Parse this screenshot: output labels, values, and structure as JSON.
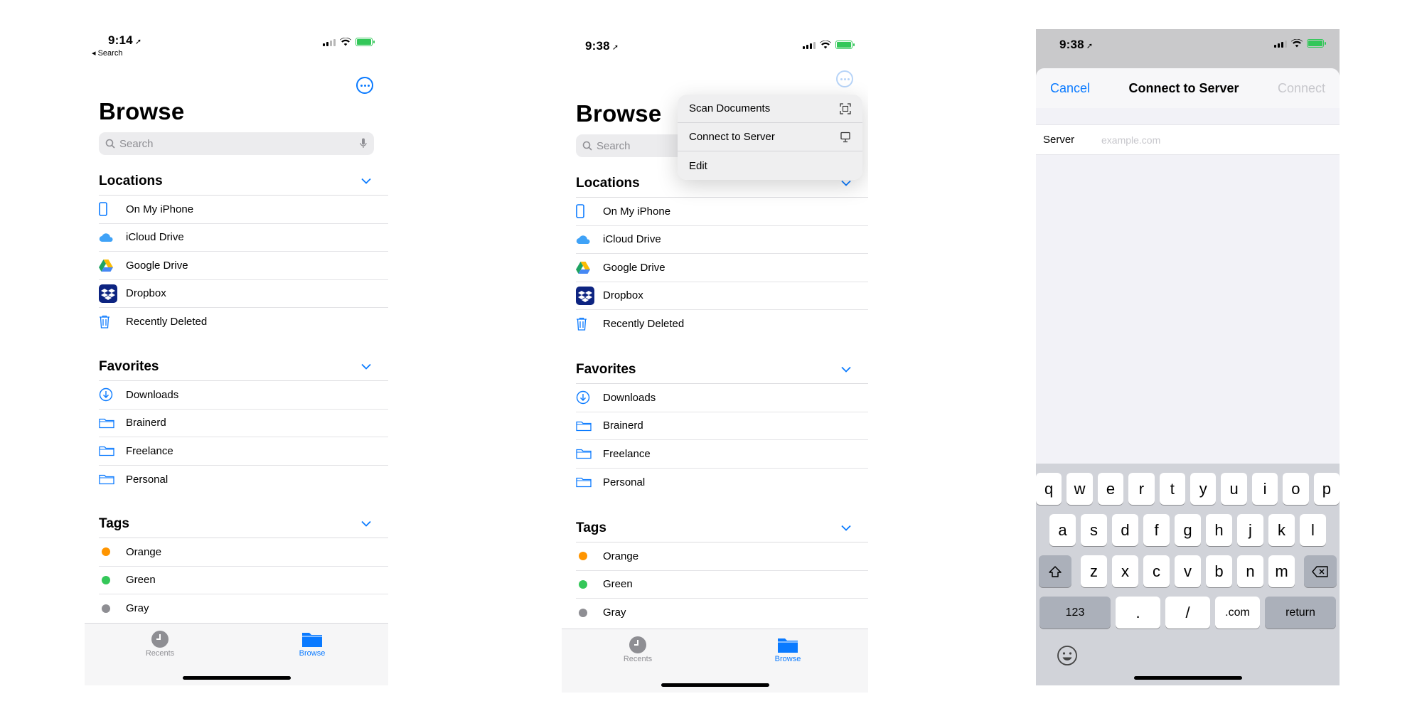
{
  "screen1": {
    "time": "9:14",
    "back_label": "◂ Search",
    "title": "Browse",
    "search_placeholder": "Search",
    "sections": [
      {
        "title": "Locations",
        "items": [
          "On My iPhone",
          "iCloud Drive",
          "Google Drive",
          "Dropbox",
          "Recently Deleted"
        ]
      },
      {
        "title": "Favorites",
        "items": [
          "Downloads",
          "Brainerd",
          "Freelance",
          "Personal"
        ]
      },
      {
        "title": "Tags",
        "items": [
          "Orange",
          "Green",
          "Gray"
        ]
      }
    ],
    "tabs": [
      "Recents",
      "Browse"
    ]
  },
  "screen2": {
    "time": "9:38",
    "title": "Browse",
    "search_placeholder": "Search",
    "menu": [
      "Scan Documents",
      "Connect to Server",
      "Edit"
    ],
    "sections": [
      {
        "title": "Locations",
        "items": [
          "On My iPhone",
          "iCloud Drive",
          "Google Drive",
          "Dropbox",
          "Recently Deleted"
        ]
      },
      {
        "title": "Favorites",
        "items": [
          "Downloads",
          "Brainerd",
          "Freelance",
          "Personal"
        ]
      },
      {
        "title": "Tags",
        "items": [
          "Orange",
          "Green",
          "Gray"
        ]
      }
    ],
    "tabs": [
      "Recents",
      "Browse"
    ]
  },
  "screen3": {
    "time": "9:38",
    "cancel": "Cancel",
    "heading": "Connect to Server",
    "connect": "Connect",
    "server_label": "Server",
    "server_placeholder": "example.com",
    "keys_row1": [
      "q",
      "w",
      "e",
      "r",
      "t",
      "y",
      "u",
      "i",
      "o",
      "p"
    ],
    "keys_row2": [
      "a",
      "s",
      "d",
      "f",
      "g",
      "h",
      "j",
      "k",
      "l"
    ],
    "keys_row3": [
      "z",
      "x",
      "c",
      "v",
      "b",
      "n",
      "m"
    ],
    "key_123": "123",
    "key_dot": ".",
    "key_slash": "/",
    "key_com": ".com",
    "key_return": "return"
  },
  "colors": {
    "accent": "#0a7aff",
    "orange": "#ff9500",
    "green": "#34c759",
    "gray": "#8e8e93"
  }
}
